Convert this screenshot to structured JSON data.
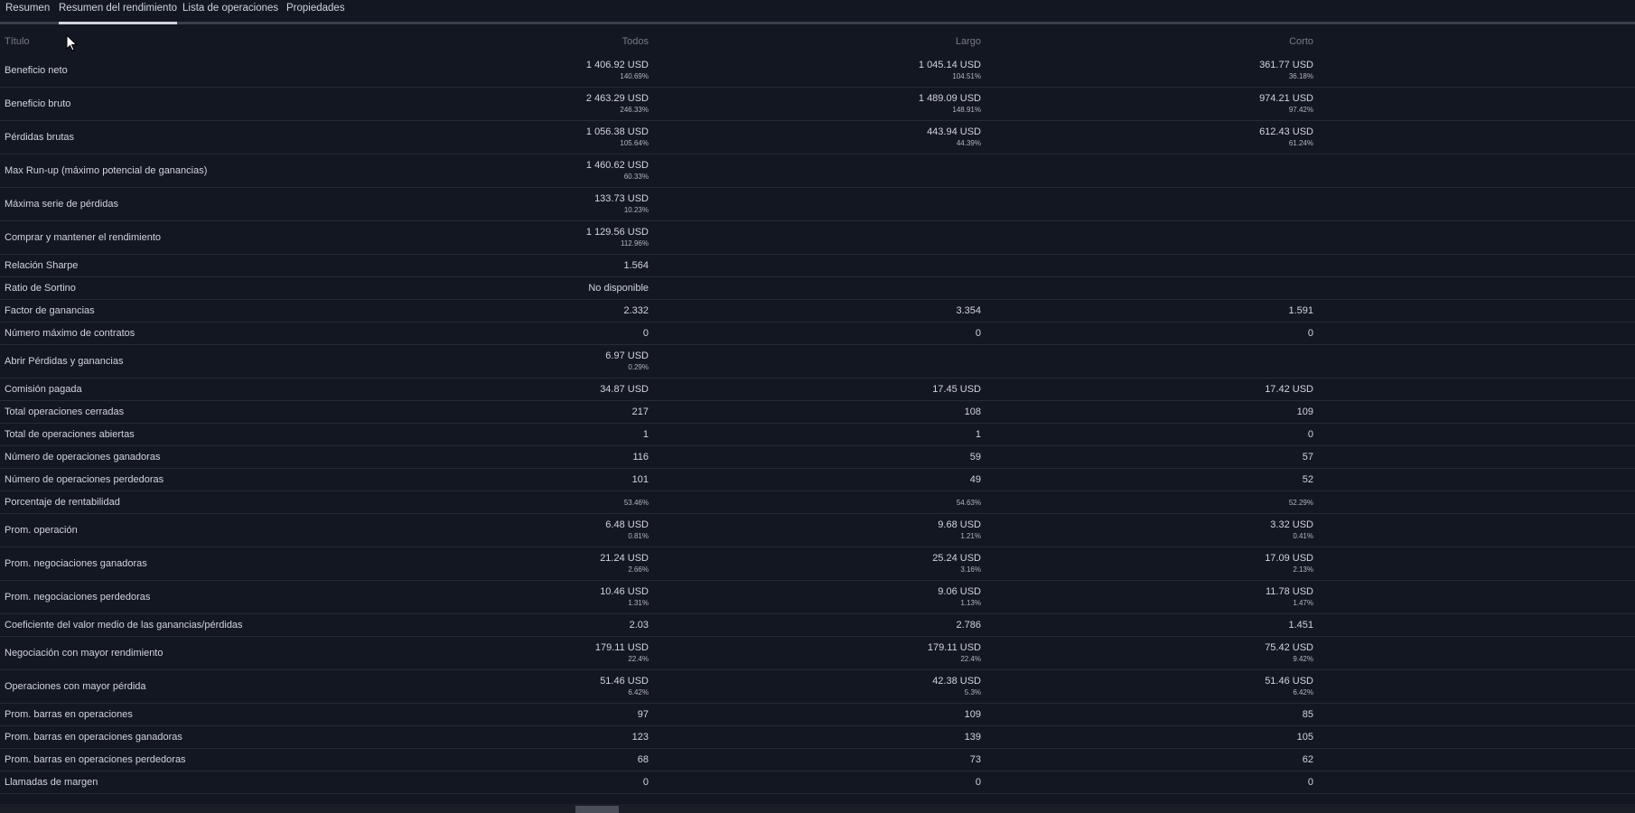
{
  "tabs": [
    {
      "label": "Resumen"
    },
    {
      "label": "Resumen del rendimiento"
    },
    {
      "label": "Lista de operaciones"
    },
    {
      "label": "Propiedades"
    }
  ],
  "active_tab": "Resumen del rendimiento",
  "table": {
    "headers": {
      "title": "Título",
      "all": "Todos",
      "long": "Largo",
      "short": "Corto"
    },
    "rows": [
      {
        "title": "Beneficio neto",
        "all": {
          "v": "1 406.92 USD",
          "p": "140.69%"
        },
        "long": {
          "v": "1 045.14 USD",
          "p": "104.51%"
        },
        "short": {
          "v": "361.77 USD",
          "p": "36.18%"
        }
      },
      {
        "title": "Beneficio bruto",
        "all": {
          "v": "2 463.29 USD",
          "p": "246.33%"
        },
        "long": {
          "v": "1 489.09 USD",
          "p": "148.91%"
        },
        "short": {
          "v": "974.21 USD",
          "p": "97.42%"
        }
      },
      {
        "title": "Pérdidas brutas",
        "all": {
          "v": "1 056.38 USD",
          "p": "105.64%"
        },
        "long": {
          "v": "443.94 USD",
          "p": "44.39%"
        },
        "short": {
          "v": "612.43 USD",
          "p": "61.24%"
        }
      },
      {
        "title": "Max Run-up (máximo potencial de ganancias)",
        "all": {
          "v": "1 460.62 USD",
          "p": "60.33%"
        },
        "long": null,
        "short": null
      },
      {
        "title": "Máxima serie de pérdidas",
        "all": {
          "v": "133.73 USD",
          "p": "10.23%"
        },
        "long": null,
        "short": null
      },
      {
        "title": "Comprar y mantener el rendimiento",
        "all": {
          "v": "1 129.56 USD",
          "p": "112.96%"
        },
        "long": null,
        "short": null
      },
      {
        "title": "Relación Sharpe",
        "all": {
          "v": "1.564"
        },
        "long": null,
        "short": null
      },
      {
        "title": "Ratio de Sortino",
        "all": {
          "v": "No disponible"
        },
        "long": null,
        "short": null
      },
      {
        "title": "Factor de ganancias",
        "all": {
          "v": "2.332"
        },
        "long": {
          "v": "3.354"
        },
        "short": {
          "v": "1.591"
        }
      },
      {
        "title": "Número máximo de contratos",
        "all": {
          "v": "0"
        },
        "long": {
          "v": "0"
        },
        "short": {
          "v": "0"
        }
      },
      {
        "title": "Abrir Pérdidas y ganancias",
        "all": {
          "v": "6.97 USD",
          "p": "0.29%"
        },
        "long": null,
        "short": null
      },
      {
        "title": "Comisión pagada",
        "all": {
          "v": "34.87 USD"
        },
        "long": {
          "v": "17.45 USD"
        },
        "short": {
          "v": "17.42 USD"
        }
      },
      {
        "title": "Total operaciones cerradas",
        "all": {
          "v": "217"
        },
        "long": {
          "v": "108"
        },
        "short": {
          "v": "109"
        }
      },
      {
        "title": "Total de operaciones abiertas",
        "all": {
          "v": "1"
        },
        "long": {
          "v": "1"
        },
        "short": {
          "v": "0"
        }
      },
      {
        "title": "Número de operaciones ganadoras",
        "all": {
          "v": "116"
        },
        "long": {
          "v": "59"
        },
        "short": {
          "v": "57"
        }
      },
      {
        "title": "Número de operaciones perdedoras",
        "all": {
          "v": "101"
        },
        "long": {
          "v": "49"
        },
        "short": {
          "v": "52"
        }
      },
      {
        "title": "Porcentaje de rentabilidad",
        "all": {
          "p": "53.46%"
        },
        "long": {
          "p": "54.63%"
        },
        "short": {
          "p": "52.29%"
        }
      },
      {
        "title": "Prom. operación",
        "all": {
          "v": "6.48 USD",
          "p": "0.81%"
        },
        "long": {
          "v": "9.68 USD",
          "p": "1.21%"
        },
        "short": {
          "v": "3.32 USD",
          "p": "0.41%"
        }
      },
      {
        "title": "Prom. negociaciones ganadoras",
        "all": {
          "v": "21.24 USD",
          "p": "2.66%"
        },
        "long": {
          "v": "25.24 USD",
          "p": "3.16%"
        },
        "short": {
          "v": "17.09 USD",
          "p": "2.13%"
        }
      },
      {
        "title": "Prom. negociaciones perdedoras",
        "all": {
          "v": "10.46 USD",
          "p": "1.31%"
        },
        "long": {
          "v": "9.06 USD",
          "p": "1.13%"
        },
        "short": {
          "v": "11.78 USD",
          "p": "1.47%"
        }
      },
      {
        "title": "Coeficiente del valor medio de las ganancias/pérdidas",
        "all": {
          "v": "2.03"
        },
        "long": {
          "v": "2.786"
        },
        "short": {
          "v": "1.451"
        }
      },
      {
        "title": "Negociación con mayor rendimiento",
        "all": {
          "v": "179.11 USD",
          "p": "22.4%"
        },
        "long": {
          "v": "179.11 USD",
          "p": "22.4%"
        },
        "short": {
          "v": "75.42 USD",
          "p": "9.42%"
        }
      },
      {
        "title": "Operaciones con mayor pérdida",
        "all": {
          "v": "51.46 USD",
          "p": "6.42%"
        },
        "long": {
          "v": "42.38 USD",
          "p": "5.3%"
        },
        "short": {
          "v": "51.46 USD",
          "p": "6.42%"
        }
      },
      {
        "title": "Prom. barras en operaciones",
        "all": {
          "v": "97"
        },
        "long": {
          "v": "109"
        },
        "short": {
          "v": "85"
        }
      },
      {
        "title": "Prom. barras en operaciones ganadoras",
        "all": {
          "v": "123"
        },
        "long": {
          "v": "139"
        },
        "short": {
          "v": "105"
        }
      },
      {
        "title": "Prom. barras en operaciones perdedoras",
        "all": {
          "v": "68"
        },
        "long": {
          "v": "73"
        },
        "short": {
          "v": "62"
        }
      },
      {
        "title": "Llamadas de margen",
        "all": {
          "v": "0"
        },
        "long": {
          "v": "0"
        },
        "short": {
          "v": "0"
        }
      }
    ]
  },
  "colors": {
    "background": "#131722",
    "text": "#d1d4dc",
    "muted": "#787b86"
  },
  "icons": {
    "cursor": "mouse-pointer-icon"
  }
}
